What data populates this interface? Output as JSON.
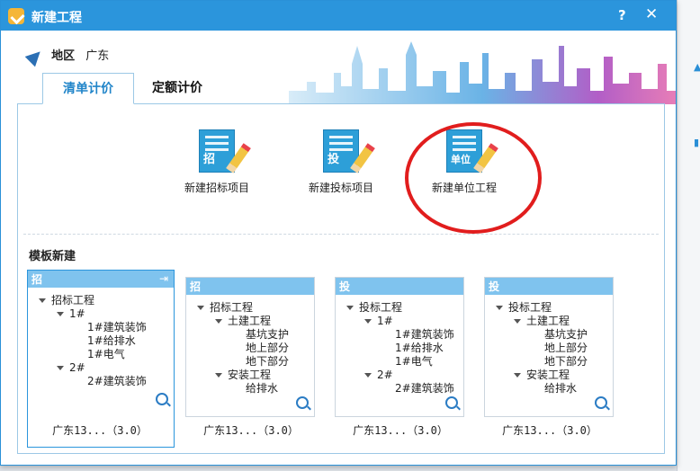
{
  "window": {
    "title": "新建工程",
    "help": "?",
    "close": "✕"
  },
  "region": {
    "label": "地区",
    "value": "广东"
  },
  "tabs": [
    {
      "label": "清单计价"
    },
    {
      "label": "定额计价"
    }
  ],
  "actions": [
    {
      "badge": "招",
      "label": "新建招标项目"
    },
    {
      "badge": "投",
      "label": "新建投标项目"
    },
    {
      "badge": "单位",
      "label": "新建单位工程"
    }
  ],
  "templates": {
    "title": "模板新建",
    "cards": [
      {
        "tag": "招",
        "root": "招标工程",
        "rows": [
          "1#",
          "1#建筑装饰",
          "1#给排水",
          "1#电气",
          "2#",
          "2#建筑装饰"
        ],
        "footer": "广东13...（3.0）"
      },
      {
        "tag": "招",
        "root": "招标工程",
        "rows": [
          "土建工程",
          "基坑支护",
          "地上部分",
          "地下部分",
          "安装工程",
          "给排水"
        ],
        "footer": "广东13...（3.0）"
      },
      {
        "tag": "投",
        "root": "投标工程",
        "rows": [
          "1#",
          "1#建筑装饰",
          "1#给排水",
          "1#电气",
          "2#",
          "2#建筑装饰"
        ],
        "footer": "广东13...（3.0）"
      },
      {
        "tag": "投",
        "root": "投标工程",
        "rows": [
          "土建工程",
          "基坑支护",
          "地上部分",
          "地下部分",
          "安装工程",
          "给排水"
        ],
        "footer": "广东13...（3.0）"
      }
    ]
  },
  "colors": {
    "accent": "#2b95dc",
    "highlight_circle": "#e11d1d"
  }
}
